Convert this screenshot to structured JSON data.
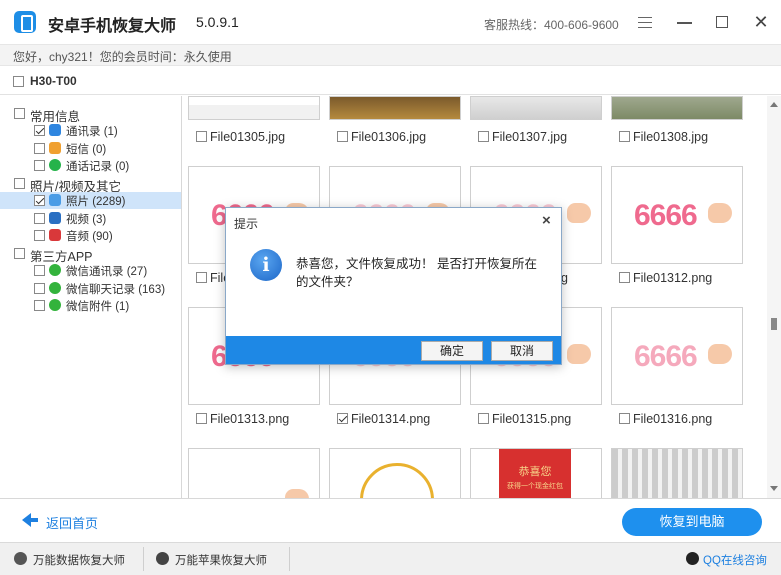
{
  "app": {
    "title": "安卓手机恢复大师",
    "version": "5.0.9.1",
    "hotline": "客服热线：400-606-9600",
    "member_info": "您好，chy321！您的会员时间：永久使用"
  },
  "device": {
    "name": "H30-T00"
  },
  "sidebar": {
    "cat_common": "常用信息",
    "contacts": "通讯录 (1)",
    "sms": "短信 (0)",
    "calls": "通话记录 (0)",
    "cat_media": "照片/视频及其它",
    "photos": "照片 (2289)",
    "videos": "视频 (3)",
    "audio": "音频 (90)",
    "cat_thirdparty": "第三方APP",
    "wechat_contacts": "微信通讯录 (27)",
    "wechat_chats": "微信聊天记录 (163)",
    "wechat_attach": "微信附件 (1)"
  },
  "files": {
    "f1305": "File01305.jpg",
    "f1306": "File01306.jpg",
    "f1307": "File01307.jpg",
    "f1308": "File01308.jpg",
    "f1309_partial": "File",
    "f1311_partial": "ng",
    "f1312": "File01312.png",
    "f1313": "File01313.png",
    "f1314": "File01314.png",
    "f1315": "File01315.png",
    "f1316": "File01316.png"
  },
  "thumbs": {
    "t6666": "6666",
    "red_card_line1": "恭喜您",
    "red_card_line2": "获得一个现金红包"
  },
  "dialog": {
    "title": "提示",
    "message": "恭喜您，文件恢复成功！ 是否打开恢复所在的文件夹？",
    "ok": "确定",
    "cancel": "取消"
  },
  "bottom": {
    "back": "返回首页",
    "recover": "恢复到电脑"
  },
  "footer": {
    "data_recovery": "万能数据恢复大师",
    "apple_recovery": "万能苹果恢复大师",
    "qq": "QQ在线咨询"
  },
  "colors": {
    "accent": "#1e88e5",
    "selection": "#cfe4fa"
  }
}
